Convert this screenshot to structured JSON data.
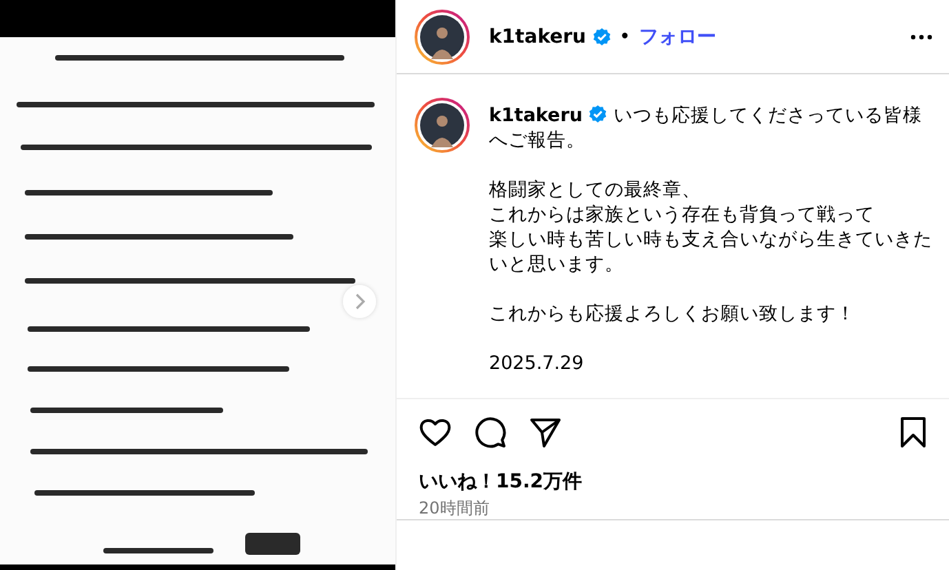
{
  "post": {
    "header": {
      "username": "k1takeru",
      "verified": true,
      "separator": "•",
      "follow": "フォロー"
    },
    "caption": {
      "username": "k1takeru",
      "verified": true,
      "paragraphs": [
        [
          "いつも応援してくださっている皆様へご報告。"
        ],
        [
          "格闘家としての最終章、",
          "これからは家族という存在も背負って戦って",
          "楽しい時も苦しい時も支え合いながら生きていきたいと思います。"
        ],
        [
          "これからも応援よろしくお願い致します！"
        ],
        [
          "2025.7.29"
        ]
      ]
    },
    "likes": "いいね！15.2万件",
    "time": "20時間前"
  }
}
